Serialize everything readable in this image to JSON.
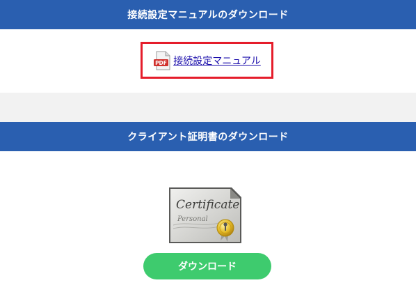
{
  "sections": {
    "manual": {
      "title": "接続設定マニュアルのダウンロード",
      "link_label": "接続設定マニュアル",
      "icon": "pdf-icon",
      "icon_text": "PDF"
    },
    "certificate": {
      "title": "クライアント証明書のダウンロード",
      "image_icon": "certificate-icon",
      "image_text_1": "Certificate",
      "image_text_2": "Personal",
      "download_label": "ダウンロード"
    }
  },
  "colors": {
    "header_bg": "#2a5fb0",
    "highlight_border": "#e51d2b",
    "button_bg": "#3ecb6e",
    "link": "#1a0dab",
    "band_bg": "#f2f2f2"
  }
}
